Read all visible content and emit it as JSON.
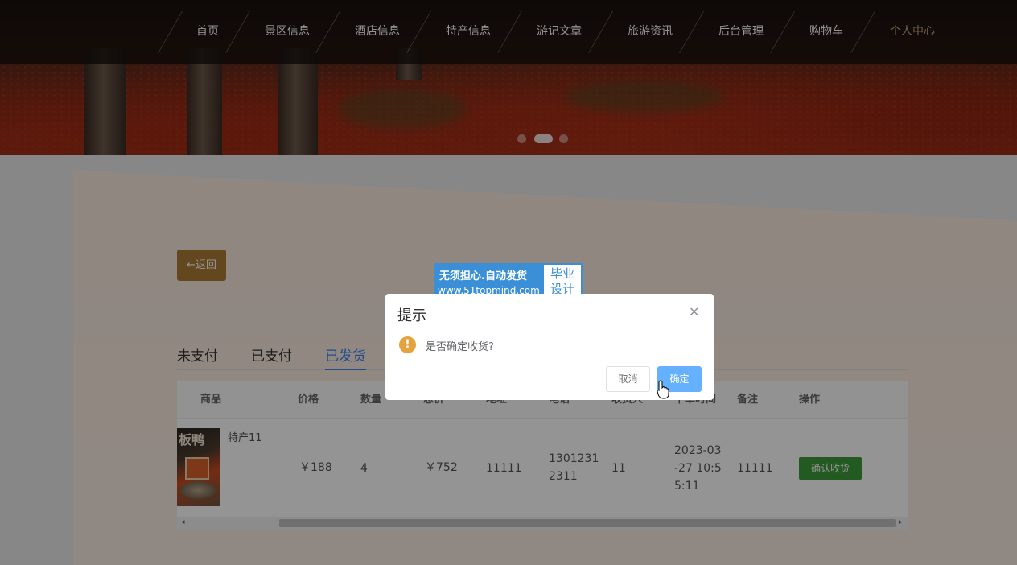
{
  "nav": {
    "items": [
      {
        "label": "首页"
      },
      {
        "label": "景区信息"
      },
      {
        "label": "酒店信息"
      },
      {
        "label": "特产信息"
      },
      {
        "label": "游记文章"
      },
      {
        "label": "旅游资讯"
      },
      {
        "label": "后台管理"
      },
      {
        "label": "购物车"
      },
      {
        "label": "个人中心"
      }
    ],
    "active_index": 8,
    "active_color": "#b8a26e"
  },
  "carousel": {
    "slides": 3,
    "active_index": 1
  },
  "back_button": {
    "label": "←返回"
  },
  "tabs": [
    {
      "label": "未支付"
    },
    {
      "label": "已支付"
    },
    {
      "label": "已发货"
    }
  ],
  "active_tab": 2,
  "table": {
    "headers": [
      "商品",
      "价格",
      "数量",
      "总价",
      "地址",
      "电话",
      "收货人",
      "下单时间",
      "备注",
      "操作"
    ],
    "rows": [
      {
        "product_name": "特产11",
        "thumb_text": "板鸭",
        "price": "￥188",
        "quantity": "4",
        "total": "￥752",
        "address": "11111",
        "phone": "1301231 2311",
        "receiver": "11",
        "order_time": "2023-03 -27 10:5 5:11",
        "remark": "11111",
        "action_label": "确认收货"
      }
    ]
  },
  "watermark": {
    "line1": "无须担心.自动发货",
    "line2": "www.51topmind.com",
    "right_line1": "毕业",
    "right_line2": "设计"
  },
  "dialog": {
    "title": "提示",
    "message": "是否确定收货?",
    "icon": "warning-icon",
    "cancel_label": "取消",
    "confirm_label": "确定",
    "close_icon": "close-icon"
  },
  "colors": {
    "accent_blue": "#3b82f6",
    "back_button": "#a97a36",
    "confirm_green": "#3d9b3a",
    "dialog_primary": "#66b1ff",
    "warning": "#e6a23c"
  }
}
